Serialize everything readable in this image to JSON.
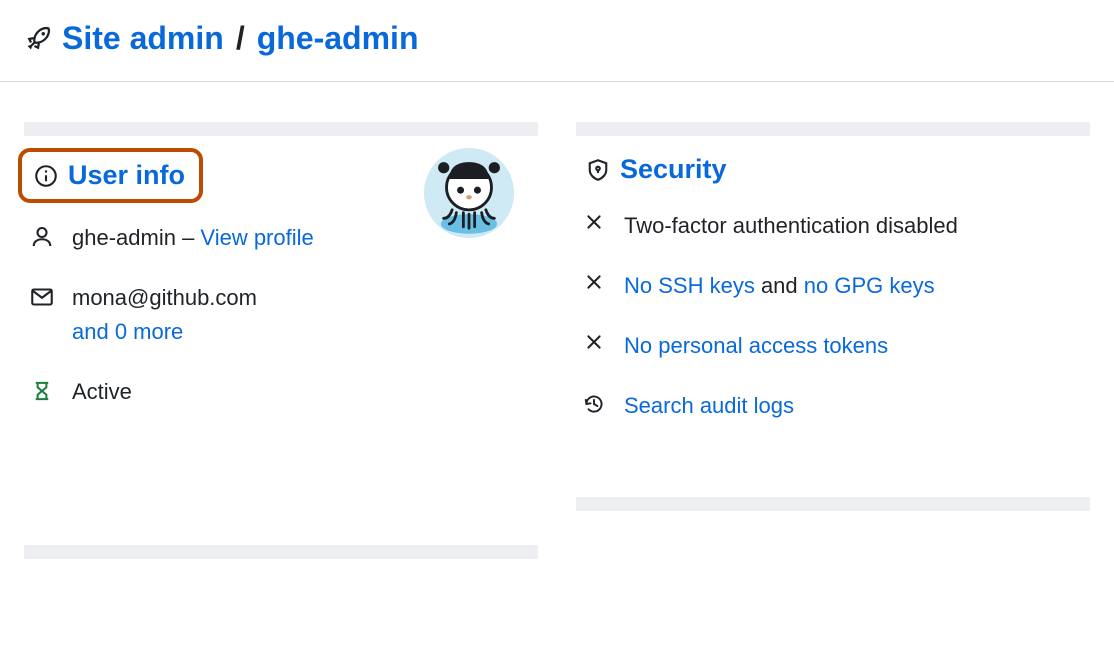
{
  "header": {
    "site_admin_label": "Site admin",
    "separator": "/",
    "username": "ghe-admin"
  },
  "user_info": {
    "title": "User info",
    "username": "ghe-admin",
    "dash": " – ",
    "view_profile_label": "View profile",
    "email": "mona@github.com",
    "and_more_label": "and 0 more",
    "status": "Active"
  },
  "security": {
    "title": "Security",
    "two_factor_text": "Two-factor authentication disabled",
    "no_ssh_keys_label": "No SSH keys",
    "and_text": " and ",
    "no_gpg_keys_label": "no GPG keys",
    "no_pat_label": "No personal access tokens",
    "search_audit_label": "Search audit logs"
  }
}
